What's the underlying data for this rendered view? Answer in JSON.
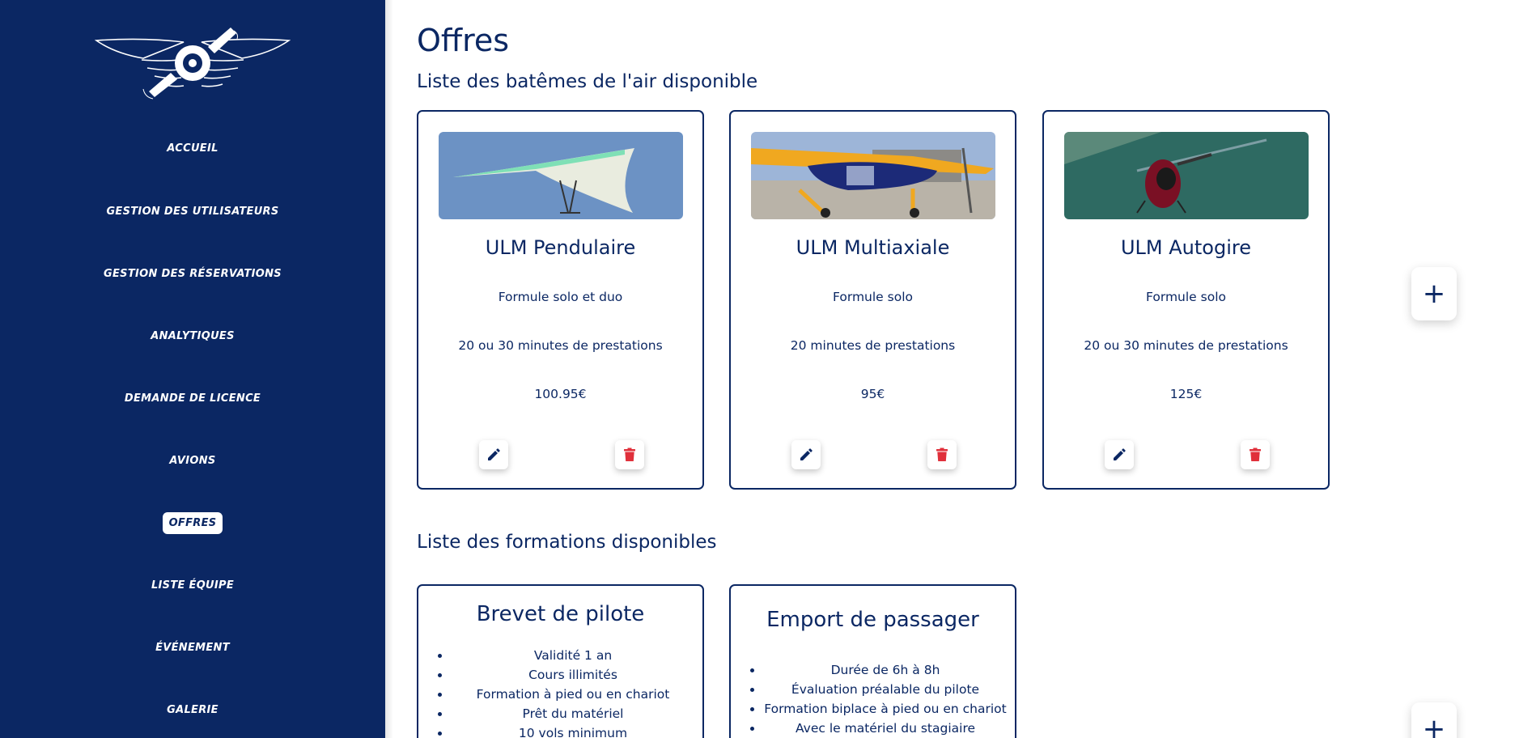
{
  "sidebar": {
    "logo": "winged-propeller-logo",
    "items": [
      {
        "label": "ACCUEIL"
      },
      {
        "label": "GESTION DES UTILISATEURS"
      },
      {
        "label": "GESTION DES RÉSERVATIONS"
      },
      {
        "label": "ANALYTIQUES"
      },
      {
        "label": "DEMANDE DE LICENCE"
      },
      {
        "label": "AVIONS"
      },
      {
        "label": "OFFRES",
        "active": true
      },
      {
        "label": "LISTE ÉQUIPE"
      },
      {
        "label": "ÉVÉNEMENT"
      },
      {
        "label": "GALERIE"
      }
    ]
  },
  "main": {
    "title": "Offres",
    "baptemes": {
      "heading": "Liste des batêmes de l'air disponible",
      "cards": [
        {
          "title": "ULM Pendulaire",
          "formule": "Formule solo et duo",
          "duree": "20 ou 30 minutes de prestations",
          "prix": "100.95€",
          "photo": "hang-glider-sky"
        },
        {
          "title": "ULM Multiaxiale",
          "formule": "Formule solo",
          "duree": "20 minutes de prestations",
          "prix": "95€",
          "photo": "yellow-plane-ground"
        },
        {
          "title": "ULM Autogire",
          "formule": "Formule solo",
          "duree": "20 ou 30 minutes de prestations",
          "prix": "125€",
          "photo": "gyrocopter-over-water"
        }
      ],
      "add_label": "+"
    },
    "formations": {
      "heading": "Liste des formations disponibles",
      "cards": [
        {
          "title": "Brevet de pilote",
          "items": [
            "Validité 1 an",
            "Cours illimités",
            "Formation à pied ou en chariot",
            "Prêt du matériel",
            "10 vols minimum"
          ]
        },
        {
          "title": "Emport de passager",
          "items": [
            "Durée de 6h à 8h",
            "Évaluation préalable du pilote",
            "Formation biplace à pied ou en chariot",
            "Avec le matériel du stagiaire"
          ]
        }
      ],
      "add_label": "+"
    }
  },
  "colors": {
    "navy": "#0b2763",
    "delete_red": "#e0303b",
    "white": "#ffffff"
  },
  "icons": {
    "edit": "pencil-icon",
    "delete": "trash-icon",
    "add": "plus-icon"
  }
}
